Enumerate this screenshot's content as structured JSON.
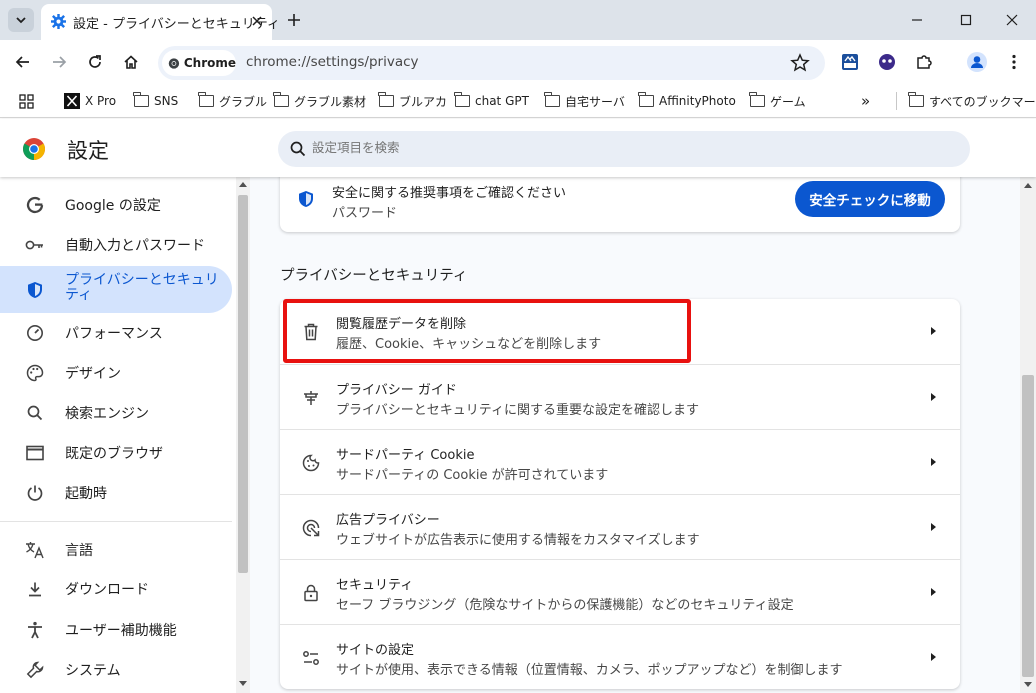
{
  "window": {
    "tab_title": "設定 - プライバシーとセキュリティ"
  },
  "toolbar": {
    "chip_label": "Chrome",
    "url": "chrome://settings/privacy"
  },
  "bookmarks": {
    "items": [
      "X Pro",
      "SNS",
      "グラブル",
      "グラブル素材",
      "ブルアカ",
      "chat GPT",
      "自宅サーバ",
      "AffinityPhoto",
      "ゲーム"
    ],
    "overflow": "»",
    "all_bookmarks": "すべてのブックマーク"
  },
  "header": {
    "title": "設定",
    "search_placeholder": "設定項目を検索"
  },
  "sidebar": {
    "items": [
      {
        "label": "Google の設定",
        "icon": "google-icon"
      },
      {
        "label": "自動入力とパスワード",
        "icon": "key-icon"
      },
      {
        "label": "プライバシーとセキュリティ",
        "icon": "shield-icon",
        "active": true
      },
      {
        "label": "パフォーマンス",
        "icon": "speedometer-icon"
      },
      {
        "label": "デザイン",
        "icon": "palette-icon"
      },
      {
        "label": "検索エンジン",
        "icon": "search-icon"
      },
      {
        "label": "既定のブラウザ",
        "icon": "browser-window-icon"
      },
      {
        "label": "起動時",
        "icon": "power-icon"
      },
      {
        "label": "言語",
        "icon": "translate-icon"
      },
      {
        "label": "ダウンロード",
        "icon": "download-icon"
      },
      {
        "label": "ユーザー補助機能",
        "icon": "accessibility-icon"
      },
      {
        "label": "システム",
        "icon": "wrench-icon"
      }
    ]
  },
  "safety_check": {
    "line1": "安全に関する推奨事項をご確認ください",
    "line2": "パスワード",
    "button": "安全チェックに移動"
  },
  "privacy": {
    "section_title": "プライバシーとセキュリティ",
    "rows": [
      {
        "title": "閲覧履歴データを削除",
        "subtitle": "履歴、Cookie、キャッシュなどを削除します",
        "icon": "trash-icon"
      },
      {
        "title": "プライバシー ガイド",
        "subtitle": "プライバシーとセキュリティに関する重要な設定を確認します",
        "icon": "privacy-guide-icon"
      },
      {
        "title": "サードパーティ Cookie",
        "subtitle": "サードパーティの Cookie が許可されています",
        "icon": "cookie-icon"
      },
      {
        "title": "広告プライバシー",
        "subtitle": "ウェブサイトが広告表示に使用する情報をカスタマイズします",
        "icon": "ad-privacy-icon"
      },
      {
        "title": "セキュリティ",
        "subtitle": "セーフ ブラウジング（危険なサイトからの保護機能）などのセキュリティ設定",
        "icon": "lock-icon"
      },
      {
        "title": "サイトの設定",
        "subtitle": "サイトが使用、表示できる情報（位置情報、カメラ、ポップアップなど）を制御します",
        "icon": "tune-icon"
      }
    ]
  },
  "colors": {
    "accent": "#0b57d0",
    "highlight": "#e8110f",
    "active_bg": "#d3e3fd"
  }
}
